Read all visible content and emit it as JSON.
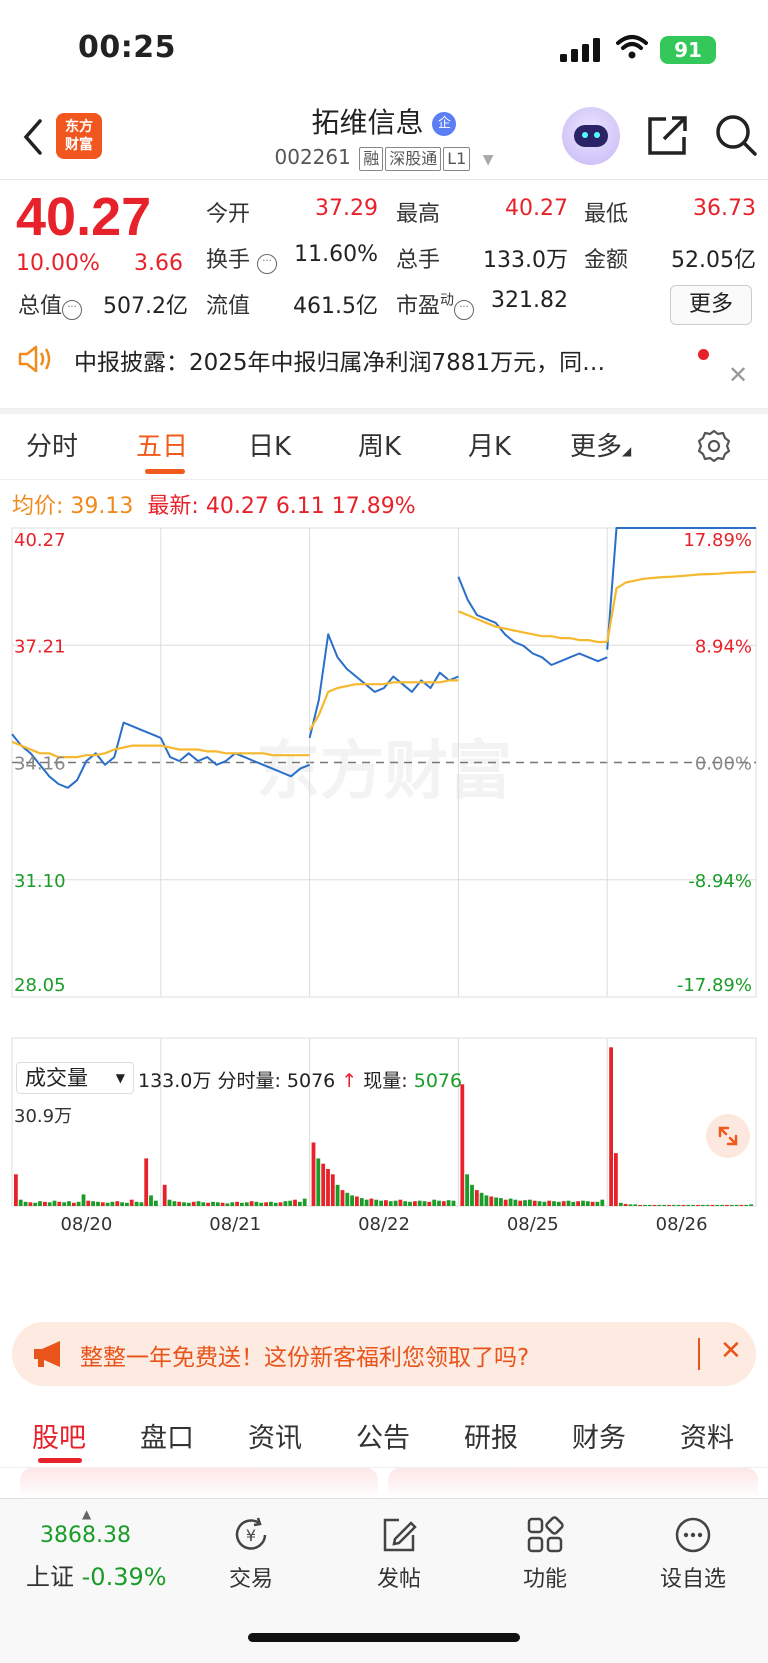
{
  "status_bar": {
    "time": "00:25",
    "battery": "91"
  },
  "header": {
    "logo_line1": "东方",
    "logo_line2": "财富",
    "stock_name": "拓维信息",
    "badge": "企",
    "code": "002261",
    "tags": [
      "融",
      "深股通",
      "L1"
    ]
  },
  "quote": {
    "price": "40.27",
    "change_pct": "10.00%",
    "change": "3.66",
    "open_label": "今开",
    "open": "37.29",
    "high_label": "最高",
    "high": "40.27",
    "low_label": "最低",
    "low": "36.73",
    "turnover_label": "换手",
    "turnover": "11.60%",
    "volume_label": "总手",
    "volume": "133.0万",
    "amount_label": "金额",
    "amount": "52.05亿",
    "mktcap_label": "总值",
    "mktcap": "507.2亿",
    "float_label": "流值",
    "float": "461.5亿",
    "pe_label": "市盈",
    "pe_sup": "动",
    "pe": "321.82",
    "more": "更多"
  },
  "news": {
    "text": "中报披露：2025年中报归属净利润7881万元，同…"
  },
  "chart_tabs": {
    "items": [
      "分时",
      "五日",
      "日K",
      "周K",
      "月K",
      "更多"
    ],
    "active": "五日"
  },
  "summary": {
    "avg_label": "均价:",
    "avg": "39.13",
    "latest_label": "最新:",
    "latest": "40.27",
    "latest_chg": "6.11",
    "latest_pct": "17.89%"
  },
  "volume_bar": {
    "selector": "成交量",
    "total": "133.0万",
    "tick_label": "分时量:",
    "tick": "5076",
    "now_label": "现量:",
    "now": "5076",
    "max_label": "30.9万"
  },
  "chart_data": {
    "type": "line",
    "y_ticks_left": [
      "40.27",
      "37.21",
      "34.16",
      "31.10",
      "28.05"
    ],
    "y_ticks_right": [
      "17.89%",
      "8.94%",
      "0.00%",
      "-8.94%",
      "-17.89%"
    ],
    "ylim": [
      28.05,
      40.27
    ],
    "prev_close": 34.16,
    "x_labels": [
      "08/20",
      "08/21",
      "08/22",
      "08/25",
      "08/26"
    ],
    "series": [
      {
        "name": "",
        "days": [
          [
            34.9,
            34.6,
            34.4,
            34.1,
            33.8,
            33.6,
            33.5,
            33.7,
            34.2,
            34.4,
            34.1,
            34.3,
            35.2,
            35.1,
            35.0,
            34.9,
            34.8
          ],
          [
            34.8,
            34.3,
            34.2,
            34.4,
            34.2,
            34.3,
            34.1,
            34.2,
            34.4,
            34.3,
            34.2,
            34.1,
            34.0,
            33.9,
            33.8,
            34.0,
            34.1
          ],
          [
            34.8,
            35.8,
            37.5,
            36.9,
            36.6,
            36.4,
            36.2,
            36.0,
            36.1,
            36.4,
            36.2,
            36.0,
            36.3,
            36.1,
            36.5,
            36.3,
            36.4
          ],
          [
            39.0,
            38.4,
            38.0,
            37.9,
            37.8,
            37.5,
            37.3,
            37.2,
            37.0,
            36.9,
            36.7,
            36.8,
            36.9,
            37.0,
            36.9,
            36.8,
            36.9
          ],
          [
            37.1,
            40.27,
            40.27,
            40.27,
            40.27,
            40.27,
            40.27,
            40.27,
            40.27,
            40.27,
            40.27,
            40.27,
            40.27,
            40.27,
            40.27,
            40.27,
            40.27
          ]
        ]
      },
      {
        "name": "均价",
        "days": [
          [
            34.7,
            34.6,
            34.5,
            34.4,
            34.4,
            34.3,
            34.3,
            34.3,
            34.35,
            34.35,
            34.4,
            34.5,
            34.55,
            34.6,
            34.6,
            34.6,
            34.6
          ],
          [
            34.6,
            34.55,
            34.5,
            34.5,
            34.5,
            34.45,
            34.45,
            34.4,
            34.4,
            34.4,
            34.4,
            34.4,
            34.35,
            34.35,
            34.35,
            34.35,
            34.35
          ],
          [
            35.0,
            35.4,
            36.0,
            36.1,
            36.15,
            36.2,
            36.2,
            36.2,
            36.2,
            36.25,
            36.25,
            36.25,
            36.25,
            36.25,
            36.25,
            36.3,
            36.3
          ],
          [
            38.1,
            38.0,
            37.9,
            37.8,
            37.7,
            37.65,
            37.6,
            37.55,
            37.5,
            37.45,
            37.45,
            37.4,
            37.4,
            37.35,
            37.35,
            37.3,
            37.3
          ],
          [
            37.3,
            38.7,
            38.85,
            38.9,
            38.95,
            38.97,
            38.99,
            39.0,
            39.02,
            39.04,
            39.06,
            39.07,
            39.08,
            39.1,
            39.11,
            39.12,
            39.13
          ]
        ]
      }
    ]
  },
  "volume_data": {
    "max": 309000,
    "days": [
      [
        60,
        12,
        8,
        7,
        6,
        9,
        8,
        7,
        10,
        8,
        7,
        9,
        6,
        8,
        22,
        10,
        9,
        8,
        7,
        6,
        8,
        9,
        7,
        6,
        12,
        8,
        7,
        90,
        20,
        10
      ],
      [
        40,
        12,
        9,
        8,
        7,
        6,
        8,
        9,
        7,
        6,
        8,
        7,
        6,
        5,
        7,
        8,
        6,
        7,
        9,
        8,
        6,
        7,
        8,
        6,
        7,
        9,
        10,
        12,
        8,
        14
      ],
      [
        120,
        90,
        80,
        70,
        60,
        40,
        30,
        25,
        20,
        18,
        15,
        12,
        14,
        12,
        10,
        11,
        9,
        10,
        12,
        9,
        8,
        9,
        10,
        9,
        8,
        12,
        10,
        9,
        11,
        10
      ],
      [
        230,
        60,
        40,
        30,
        25,
        20,
        18,
        16,
        15,
        12,
        14,
        12,
        10,
        11,
        12,
        10,
        9,
        8,
        10,
        9,
        8,
        9,
        10,
        8,
        9,
        10,
        9,
        8,
        8,
        12
      ],
      [
        300,
        100,
        6,
        4,
        3,
        3,
        2,
        2,
        2,
        2,
        2,
        2,
        2,
        2,
        2,
        2,
        2,
        2,
        2,
        2,
        2,
        2,
        2,
        2,
        2,
        2,
        2,
        2,
        2,
        3
      ]
    ]
  },
  "promo": {
    "text": "整整一年免费送！这份新客福利您领取了吗?"
  },
  "bottom_tabs": {
    "items": [
      "股吧",
      "盘口",
      "资讯",
      "公告",
      "研报",
      "财务",
      "资料"
    ],
    "active": "股吧"
  },
  "bottom_nav": {
    "index_value": "3868.38",
    "index_name": "上证",
    "index_change": "-0.39%",
    "items": [
      "交易",
      "发帖",
      "功能",
      "设自选"
    ]
  },
  "colors": {
    "up": "#e8222a",
    "down": "#1a9c28",
    "price_line": "#2a6fc9",
    "avg_line": "#f5b82e",
    "accent": "#f05a1a"
  }
}
